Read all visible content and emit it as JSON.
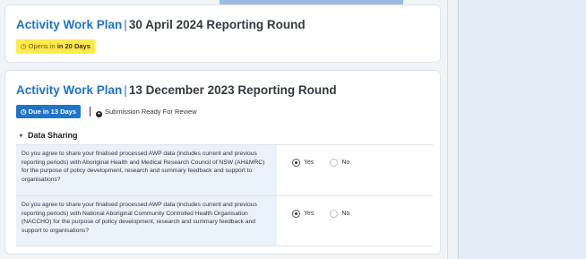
{
  "rounds": [
    {
      "title_prefix": "Activity Work Plan",
      "separator": "|",
      "title_round": "30 April 2024 Reporting Round",
      "badge_prefix": "Opens in",
      "badge_bold": "in 20 Days",
      "badge_icon": "clock-icon"
    },
    {
      "title_prefix": "Activity Work Plan",
      "separator": "|",
      "title_round": "13 December 2023 Reporting Round",
      "badge": "Due in 13 Days",
      "badge_icon": "clock-icon",
      "status": "Submission Ready For Review",
      "status_icon": "info-dot-icon"
    }
  ],
  "section": {
    "title": "Data Sharing",
    "chevron": "▾"
  },
  "questions": [
    {
      "text": "Do you agree to share your finalised processed AWP data (includes current and previous reporting periods) with Aboriginal Health and Medical Research Council of NSW (AH&MRC) for the purpose of policy development, research and summary feedback and support to organisations?",
      "yes_label": "Yes",
      "no_label": "No",
      "selected": "Yes"
    },
    {
      "text": "Do you agree to share your finalised processed AWP data (includes current and previous reporting periods) with National Aboriginal Community Controlled Health Organisation (NACCHO) for the purpose of policy development, research and summary feedback and support to organisations?",
      "yes_label": "Yes",
      "no_label": "No",
      "selected": "Yes"
    }
  ],
  "colors": {
    "brand_blue": "#1f73c9",
    "opens_badge_bg": "#ffe94d",
    "question_bg": "#e9f1fa"
  }
}
